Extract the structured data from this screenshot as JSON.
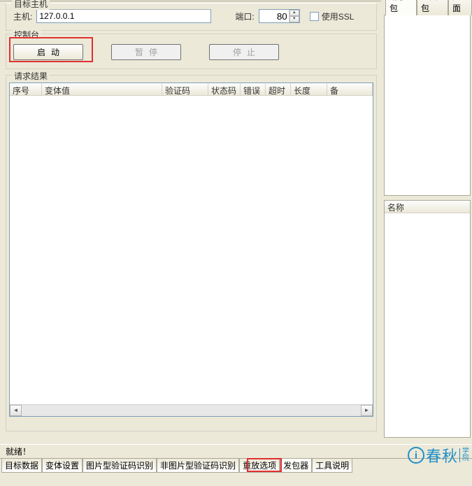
{
  "target_host": {
    "legend": "目标主机",
    "host_label": "主机:",
    "host_value": "127.0.0.1",
    "port_label": "端口:",
    "port_value": "80",
    "ssl_label": "使用SSL",
    "ssl_checked": false
  },
  "console": {
    "legend": "控制台",
    "start_label": "启动",
    "pause_label": "暂停",
    "stop_label": "停止"
  },
  "results": {
    "legend": "请求结果",
    "columns": [
      "序号",
      "变体值",
      "验证码",
      "状态码",
      "错误",
      "超时",
      "长度",
      "备"
    ]
  },
  "right_tabs": {
    "items": [
      "请求包",
      "返回包",
      "页面"
    ],
    "active_index": 0
  },
  "right_list": {
    "name_col": "名称"
  },
  "status_bar": {
    "text": "就绪！"
  },
  "bottom_tabs": {
    "items": [
      "目标数据",
      "变体设置",
      "图片型验证码识别",
      "非图片型验证码识别",
      "重放选项",
      "发包器",
      "工具说明"
    ],
    "active_index": 5
  },
  "logo": {
    "brand": "春秋",
    "sub1": "学",
    "sub2": "院"
  }
}
